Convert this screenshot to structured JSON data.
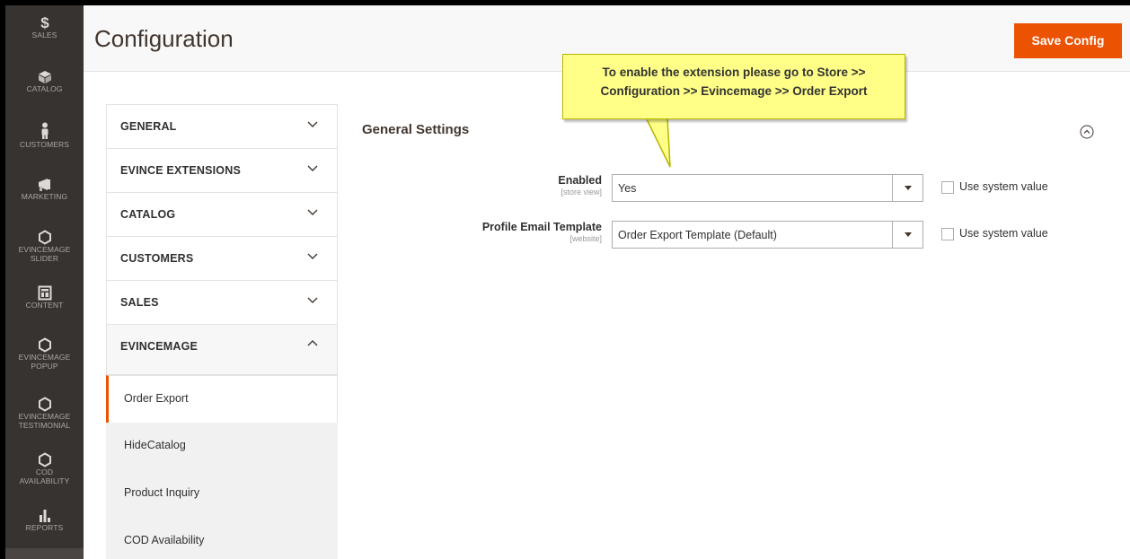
{
  "sidebar": {
    "items": [
      {
        "label": "SALES",
        "icon": "dollar-icon"
      },
      {
        "label": "CATALOG",
        "icon": "cube-icon"
      },
      {
        "label": "CUSTOMERS",
        "icon": "person-icon"
      },
      {
        "label": "MARKETING",
        "icon": "megaphone-icon"
      },
      {
        "label_lines": [
          "EVINCEMAGE",
          "SLIDER"
        ],
        "icon": "hexagon-icon"
      },
      {
        "label": "CONTENT",
        "icon": "layout-icon"
      },
      {
        "label_lines": [
          "EVINCEMAGE",
          "POPUP"
        ],
        "icon": "hexagon-icon"
      },
      {
        "label_lines": [
          "EVINCEMAGE",
          "TESTIMONIAL"
        ],
        "icon": "hexagon-icon"
      },
      {
        "label_lines": [
          "COD",
          "AVAILABILITY"
        ],
        "icon": "hexagon-icon"
      },
      {
        "label": "REPORTS",
        "icon": "bar-chart-icon"
      }
    ]
  },
  "header": {
    "title": "Configuration",
    "save_label": "Save Config"
  },
  "callout": {
    "line1": "To enable the extension please go to Store >>",
    "line2": "Configuration >> Evincemage >> Order Export"
  },
  "tabs": {
    "groups": [
      {
        "label": "GENERAL"
      },
      {
        "label": "EVINCE EXTENSIONS"
      },
      {
        "label": "CATALOG"
      },
      {
        "label": "CUSTOMERS"
      },
      {
        "label": "SALES"
      },
      {
        "label": "EVINCEMAGE"
      }
    ],
    "sub_items": [
      {
        "label": "Order Export"
      },
      {
        "label": "HideCatalog"
      },
      {
        "label": "Product Inquiry"
      },
      {
        "label": "COD Availability"
      }
    ]
  },
  "section": {
    "title": "General Settings"
  },
  "fields": [
    {
      "label": "Enabled",
      "scope": "[store view]",
      "value": "Yes",
      "checkbox_label": "Use system value"
    },
    {
      "label": "Profile Email Template",
      "scope": "[website]",
      "value": "Order Export Template (Default)",
      "checkbox_label": "Use system value"
    }
  ],
  "colors": {
    "sidebar_bg": "#373330",
    "accent": "#eb5202",
    "callout_bg": "#ffff88"
  }
}
